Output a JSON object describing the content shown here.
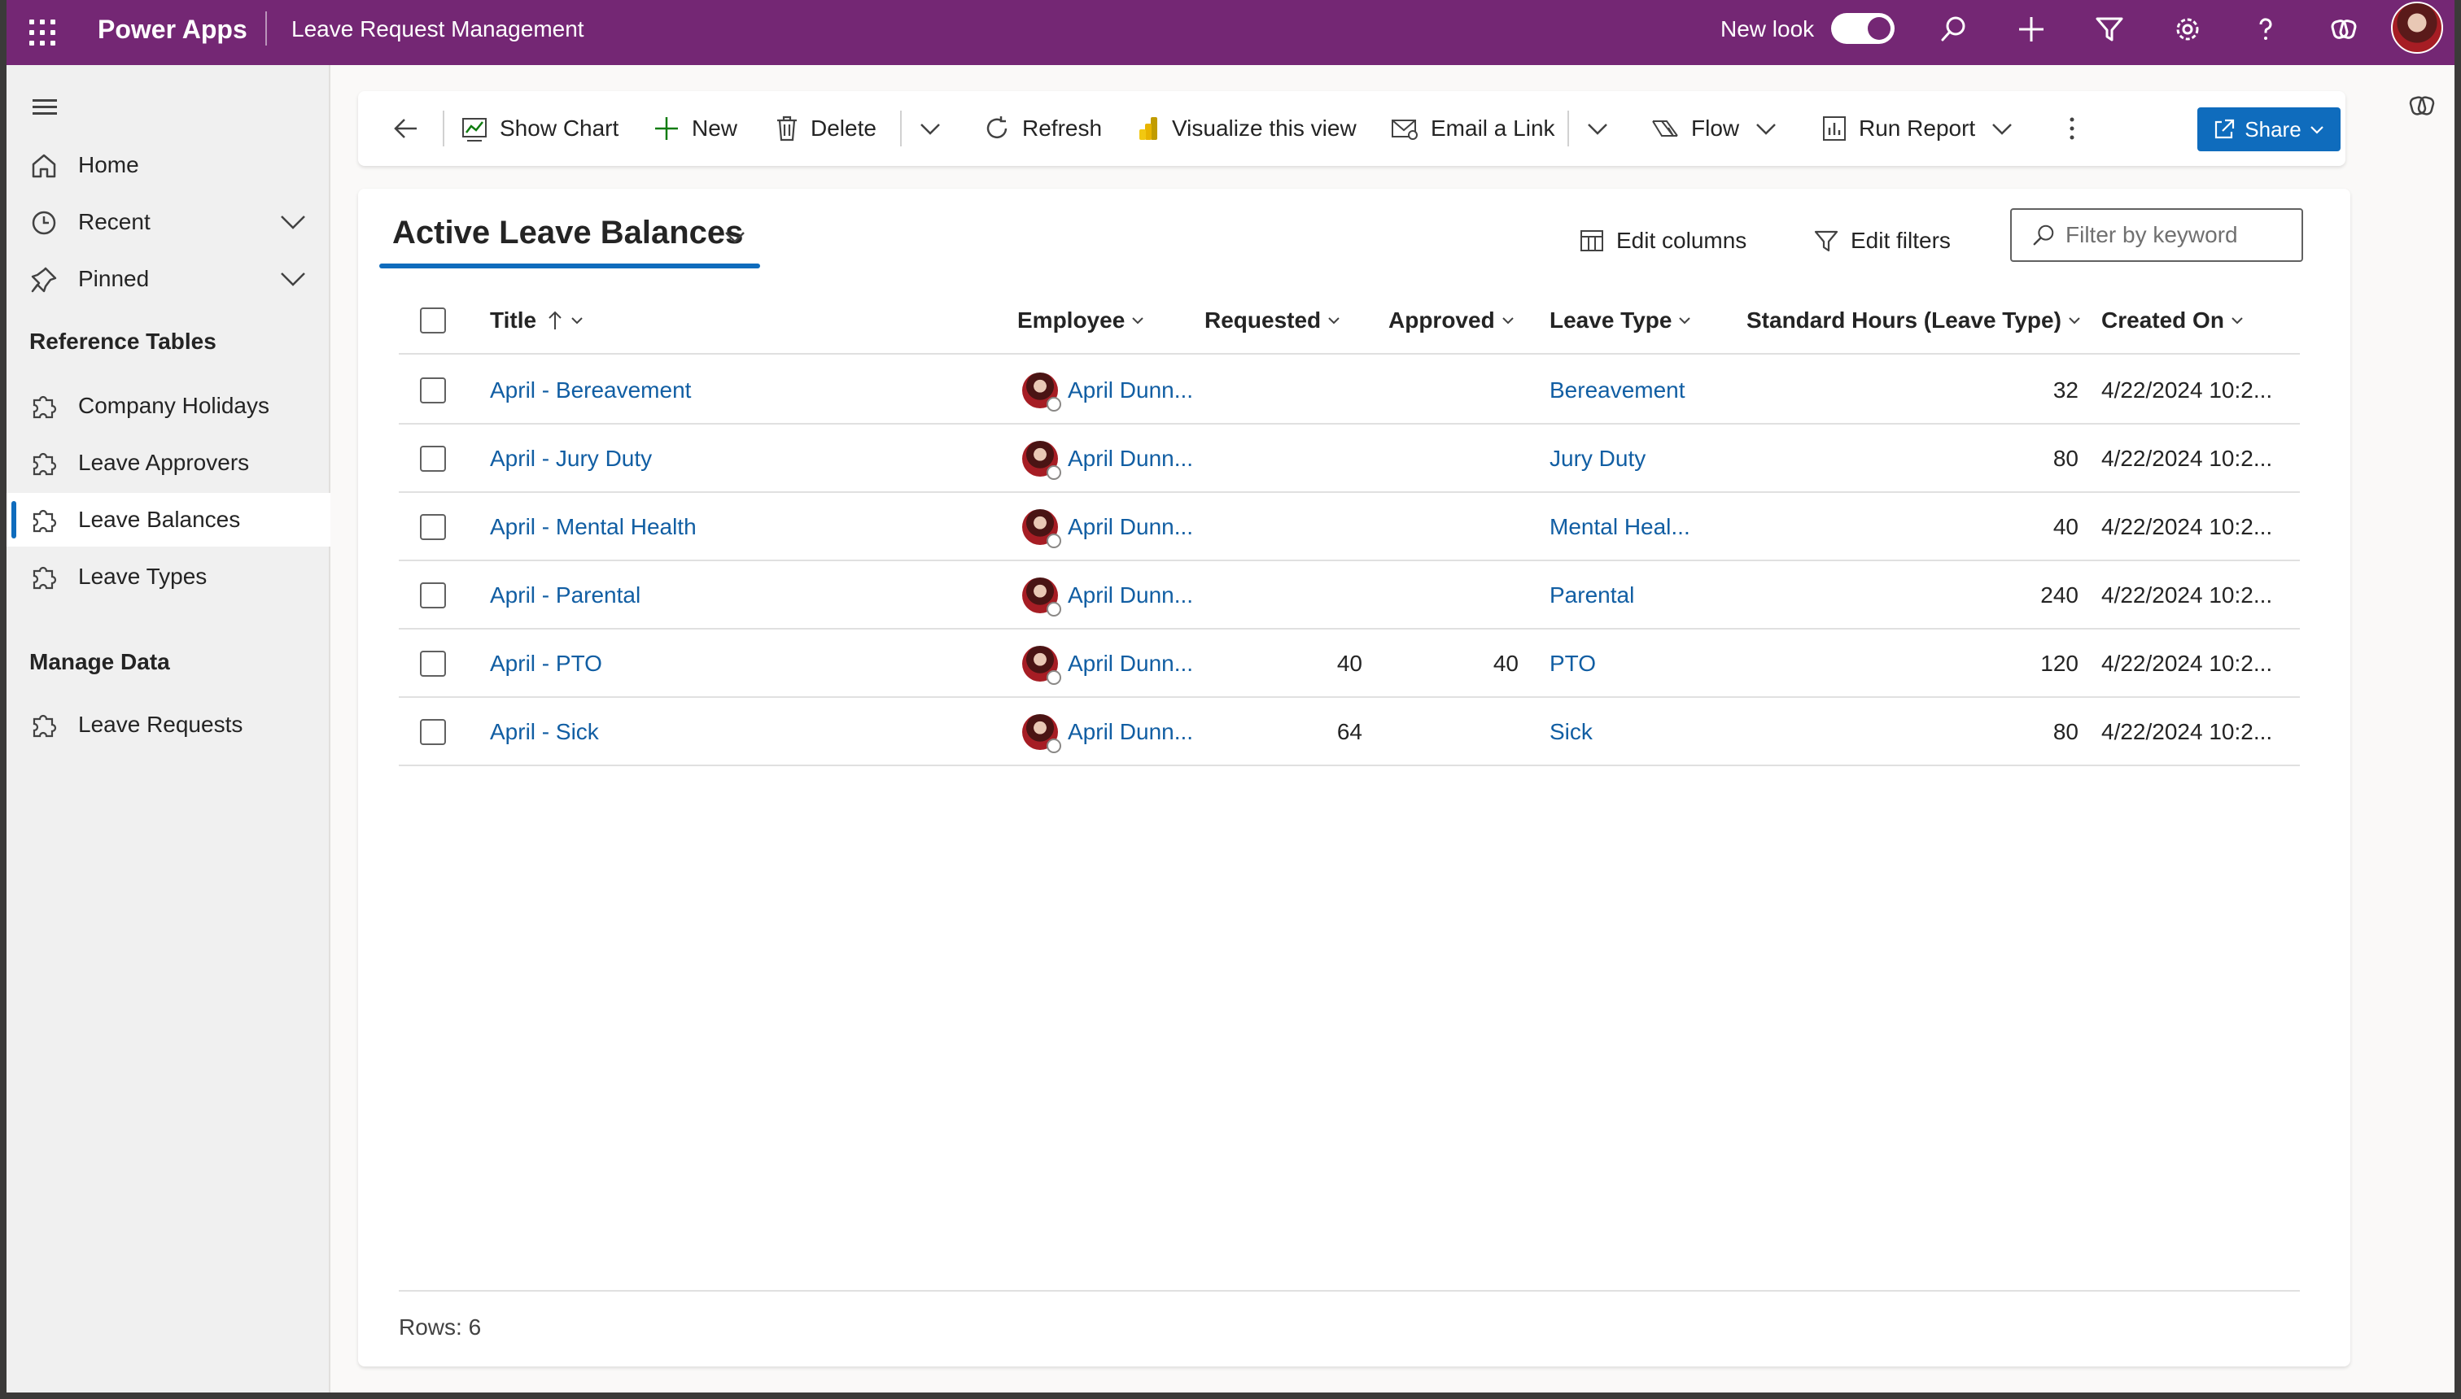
{
  "topbar": {
    "app_name": "Power Apps",
    "app_title": "Leave Request Management",
    "new_look_label": "New look",
    "new_look_on": true,
    "icons": [
      "search-icon",
      "plus-icon",
      "filter-icon",
      "settings-icon",
      "help-icon",
      "copilot-icon"
    ]
  },
  "sidebar": {
    "items_top": [
      {
        "label": "Home",
        "icon": "home-icon"
      },
      {
        "label": "Recent",
        "icon": "clock-icon",
        "expandable": true
      },
      {
        "label": "Pinned",
        "icon": "pin-icon",
        "expandable": true
      }
    ],
    "section_reference": "Reference Tables",
    "reference_items": [
      {
        "label": "Company Holidays",
        "icon": "puzzle-icon"
      },
      {
        "label": "Leave Approvers",
        "icon": "puzzle-icon"
      },
      {
        "label": "Leave Balances",
        "icon": "puzzle-icon",
        "active": true
      },
      {
        "label": "Leave Types",
        "icon": "puzzle-icon"
      }
    ],
    "section_manage": "Manage Data",
    "manage_items": [
      {
        "label": "Leave Requests",
        "icon": "puzzle-icon"
      }
    ]
  },
  "commandbar": {
    "show_chart": "Show Chart",
    "new": "New",
    "delete": "Delete",
    "refresh": "Refresh",
    "visualize": "Visualize this view",
    "email_link": "Email a Link",
    "flow": "Flow",
    "run_report": "Run Report",
    "share": "Share"
  },
  "view": {
    "title": "Active Leave Balances",
    "edit_columns": "Edit columns",
    "edit_filters": "Edit filters",
    "filter_placeholder": "Filter by keyword",
    "filter_value": "",
    "rows_label": "Rows: 6"
  },
  "columns": [
    "Title",
    "Employee",
    "Requested",
    "Approved",
    "Leave Type",
    "Standard Hours (Leave Type)",
    "Created On"
  ],
  "sort": {
    "column": "Title",
    "direction": "ascending"
  },
  "rows": [
    {
      "title": "April - Bereavement",
      "employee": "April Dunn...",
      "requested": "",
      "approved": "",
      "leave_type": "Bereavement",
      "standard_hours": "32",
      "created_on": "4/22/2024 10:2..."
    },
    {
      "title": "April - Jury Duty",
      "employee": "April Dunn...",
      "requested": "",
      "approved": "",
      "leave_type": "Jury Duty",
      "standard_hours": "80",
      "created_on": "4/22/2024 10:2..."
    },
    {
      "title": "April - Mental Health",
      "employee": "April Dunn...",
      "requested": "",
      "approved": "",
      "leave_type": "Mental Heal...",
      "standard_hours": "40",
      "created_on": "4/22/2024 10:2..."
    },
    {
      "title": "April - Parental",
      "employee": "April Dunn...",
      "requested": "",
      "approved": "",
      "leave_type": "Parental",
      "standard_hours": "240",
      "created_on": "4/22/2024 10:2..."
    },
    {
      "title": "April - PTO",
      "employee": "April Dunn...",
      "requested": "40",
      "approved": "40",
      "leave_type": "PTO",
      "standard_hours": "120",
      "created_on": "4/22/2024 10:2..."
    },
    {
      "title": "April - Sick",
      "employee": "April Dunn...",
      "requested": "64",
      "approved": "",
      "leave_type": "Sick",
      "standard_hours": "80",
      "created_on": "4/22/2024 10:2..."
    }
  ],
  "colors": {
    "topbar": "#742774",
    "accent": "#0f6cbd",
    "link": "#115ea3"
  }
}
